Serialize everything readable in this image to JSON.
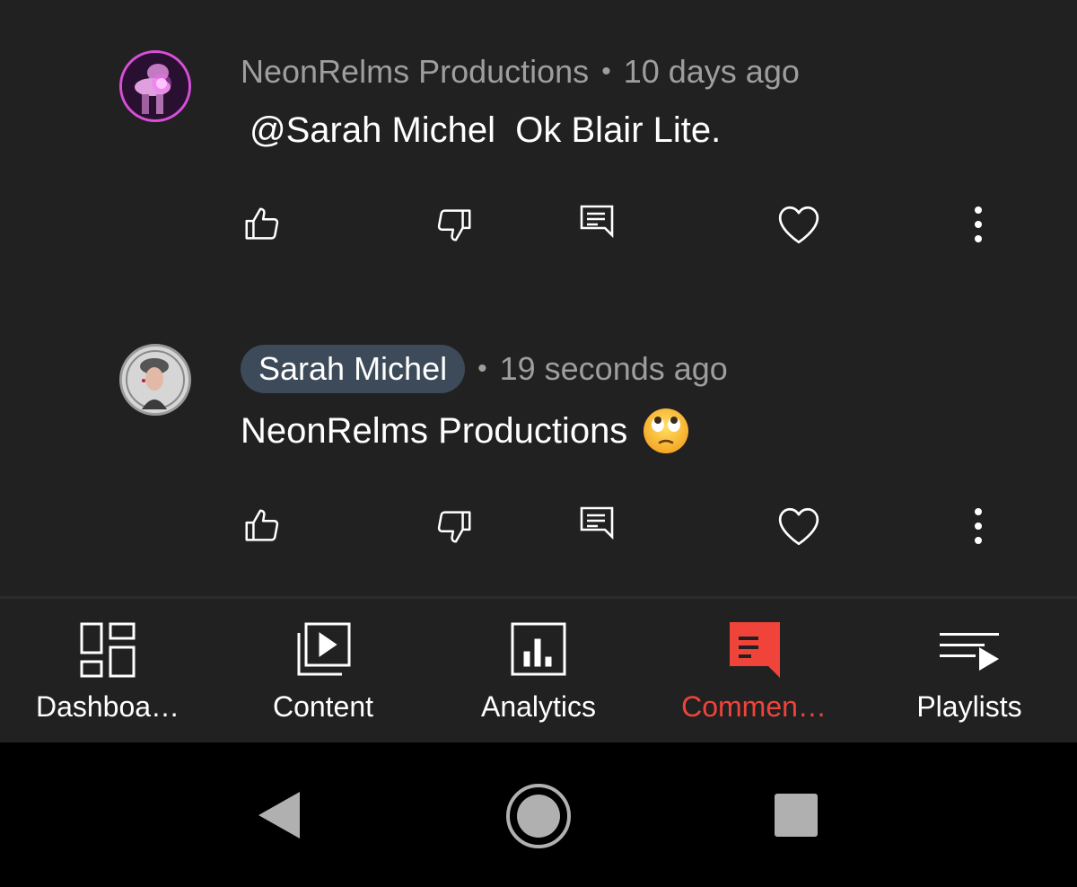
{
  "comments": [
    {
      "author": "NeonRelms Productions",
      "time": "10 days ago",
      "text": "@Sarah Michel  Ok Blair Lite.",
      "avatar_icon": "channel-avatar-pink-icon"
    },
    {
      "author": "Sarah Michel",
      "time": "19 seconds ago",
      "text": "NeonRelms Productions",
      "emoji": "face-with-rolling-eyes",
      "avatar_icon": "user-avatar-grey-icon"
    }
  ],
  "actions": [
    "thumbs-up-icon",
    "thumbs-down-icon",
    "reply-icon",
    "heart-icon",
    "more-vertical-icon"
  ],
  "bottom_nav": {
    "items": [
      {
        "label": "Dashboa…",
        "icon": "dashboard-icon"
      },
      {
        "label": "Content",
        "icon": "content-icon"
      },
      {
        "label": "Analytics",
        "icon": "analytics-icon"
      },
      {
        "label": "Commen…",
        "icon": "comments-icon",
        "active": true
      },
      {
        "label": "Playlists",
        "icon": "playlists-icon"
      }
    ]
  },
  "system_nav": [
    "back-icon",
    "home-icon",
    "recents-icon"
  ],
  "colors": {
    "background": "#212121",
    "accent_active": "#f0443a",
    "name_chip": "#3d4a59",
    "meta_text": "#9e9e9e"
  }
}
